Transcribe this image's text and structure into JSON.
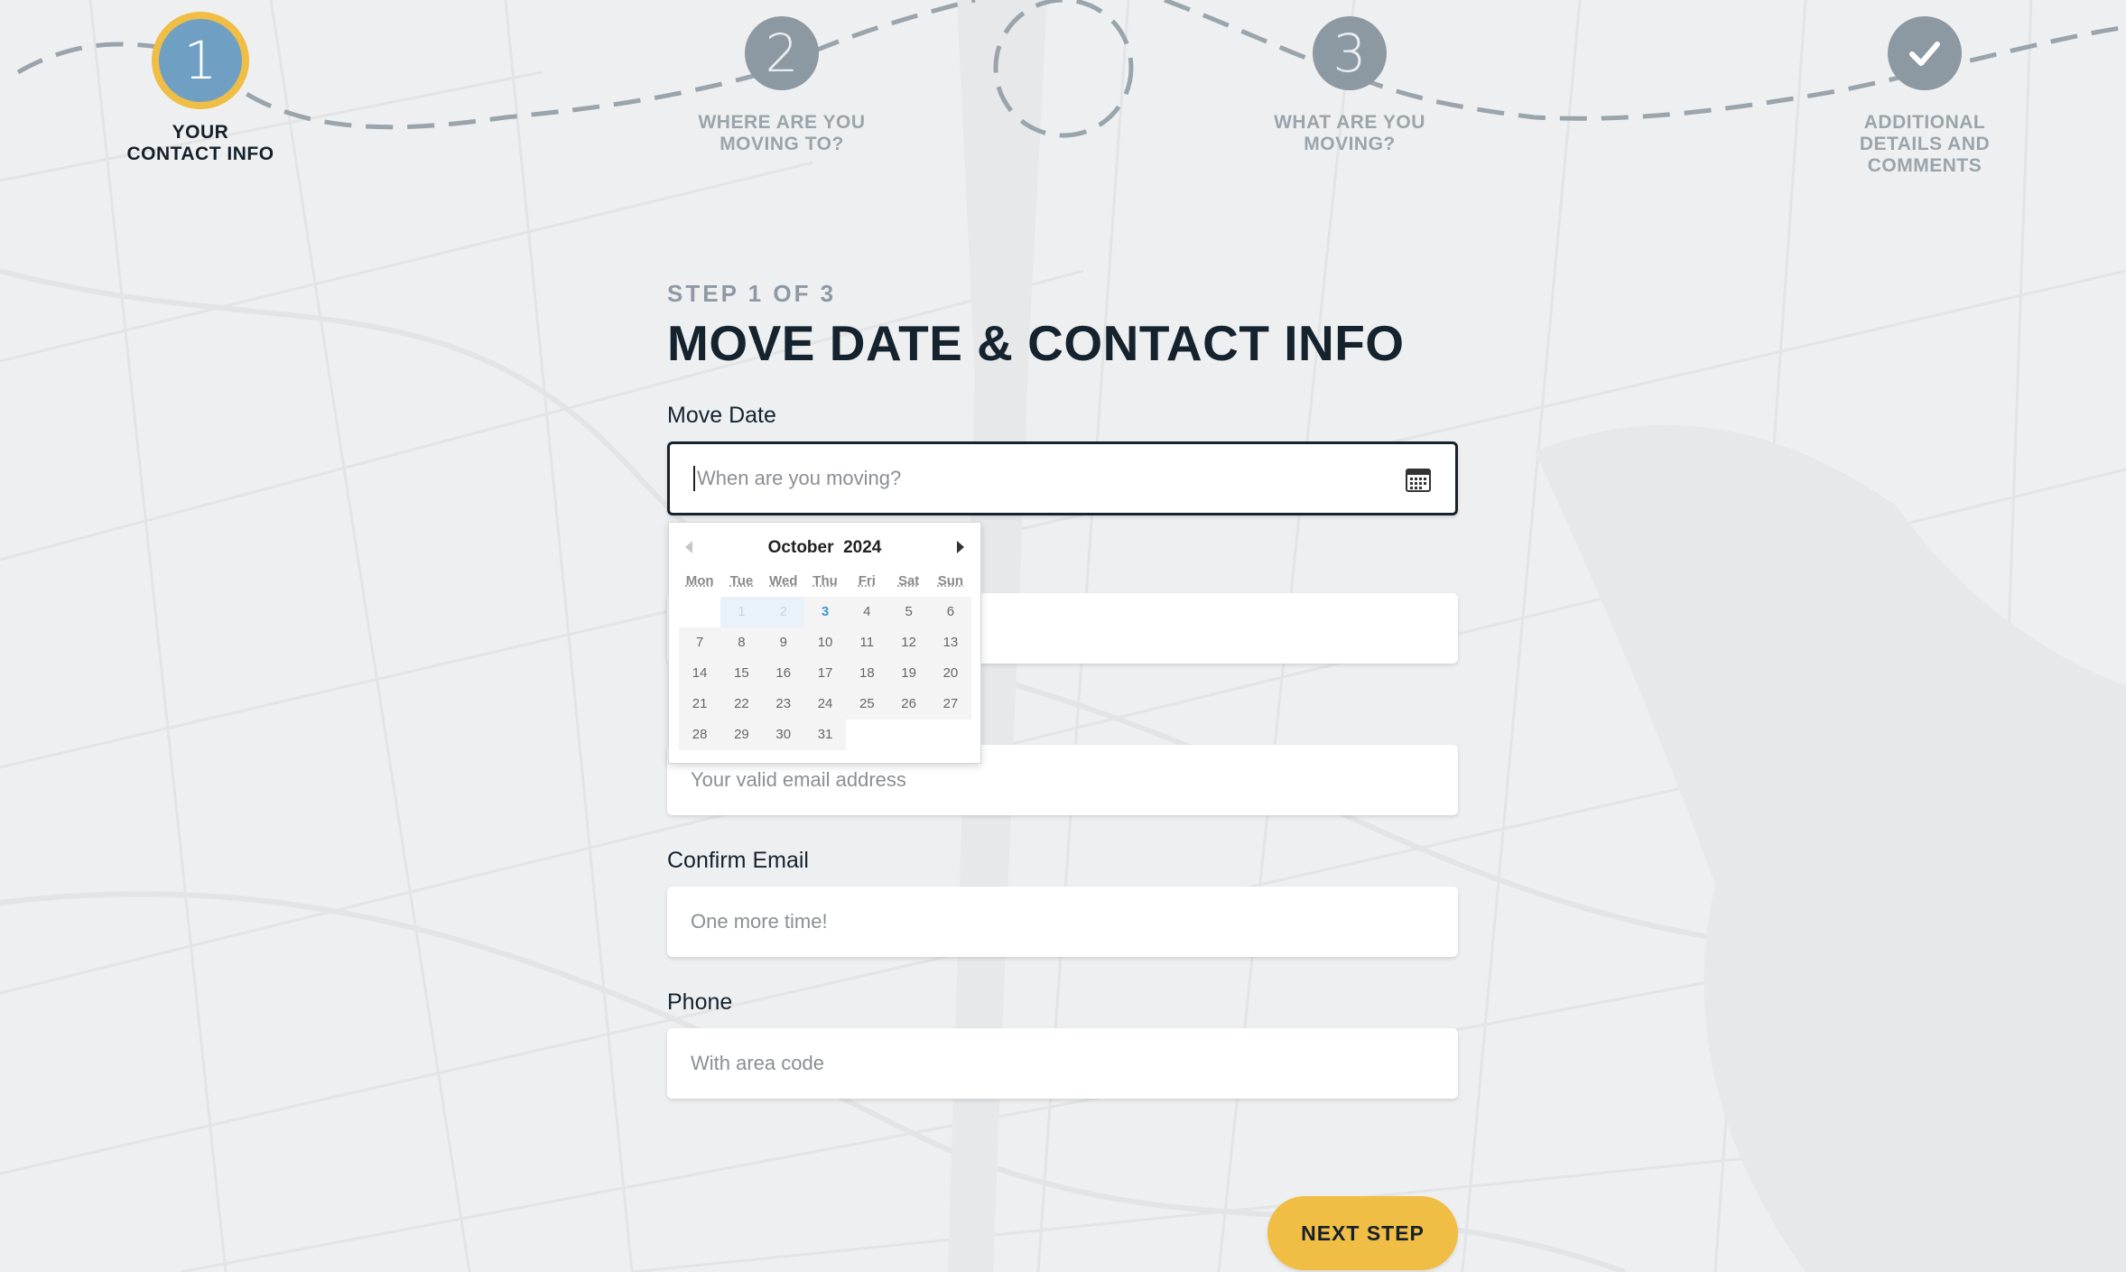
{
  "steps": [
    {
      "number": "1",
      "label": "YOUR\nCONTACT INFO",
      "active": true
    },
    {
      "number": "2",
      "label": "WHERE ARE YOU\nMOVING TO?",
      "active": false
    },
    {
      "number": "3",
      "label": "WHAT ARE YOU\nMOVING?",
      "active": false
    },
    {
      "number": "",
      "icon": "check-icon",
      "label": "ADDITIONAL\nDETAILS AND\nCOMMENTS",
      "active": false
    }
  ],
  "form": {
    "eyebrow": "STEP 1 OF 3",
    "title": "MOVE DATE & CONTACT INFO",
    "move_date": {
      "label": "Move Date",
      "placeholder": "When are you moving?"
    },
    "email": {
      "placeholder": "Your valid email address"
    },
    "confirm_email": {
      "label": "Confirm Email",
      "placeholder": "One more time!"
    },
    "phone": {
      "label": "Phone",
      "placeholder": "With area code"
    },
    "next_button": "NEXT STEP"
  },
  "datepicker": {
    "month": "October",
    "year": "2024",
    "weekdays": [
      "Mon",
      "Tue",
      "Wed",
      "Thu",
      "Fri",
      "Sat",
      "Sun"
    ],
    "days": [
      "",
      "1",
      "2",
      "3",
      "4",
      "5",
      "6",
      "7",
      "8",
      "9",
      "10",
      "11",
      "12",
      "13",
      "14",
      "15",
      "16",
      "17",
      "18",
      "19",
      "20",
      "21",
      "22",
      "23",
      "24",
      "25",
      "26",
      "27",
      "28",
      "29",
      "30",
      "31"
    ],
    "past_days": [
      "1",
      "2"
    ],
    "today": "3"
  },
  "colors": {
    "accent": "#f0bd45",
    "active_step": "#6fa0c4",
    "inactive_step": "#8d99a2",
    "heading": "#15232f"
  }
}
